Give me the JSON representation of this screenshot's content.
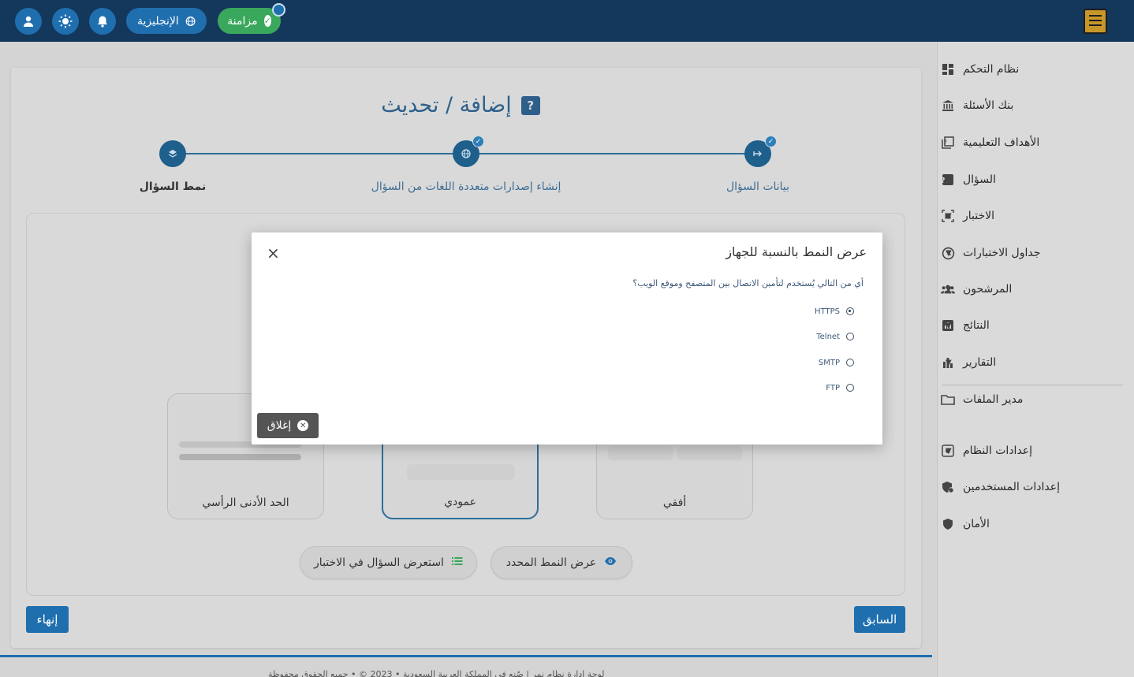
{
  "topbar": {
    "sync_label": "مزامنة",
    "language_label": "الإنجليزية"
  },
  "sidebar": {
    "items": [
      {
        "label": "نظام التحكم",
        "icon": "dashboard-icon",
        "has_caret": false
      },
      {
        "label": "بنك الأسئلة",
        "icon": "bank-icon",
        "has_caret": false
      },
      {
        "label": "الأهداف التعليمية",
        "icon": "objectives-icon",
        "has_caret": false
      },
      {
        "label": "السؤال",
        "icon": "question-icon",
        "has_caret": true
      },
      {
        "label": "الاختبار",
        "icon": "exam-icon",
        "has_caret": true
      },
      {
        "label": "جداول الاختبارات",
        "icon": "clock-icon",
        "has_caret": true
      },
      {
        "label": "المرشحون",
        "icon": "people-icon",
        "has_caret": true
      },
      {
        "label": "النتائج",
        "icon": "results-icon",
        "has_caret": true
      },
      {
        "label": "التقارير",
        "icon": "bar-chart-icon",
        "has_caret": true
      },
      {
        "label": "مدير الملفات",
        "icon": "folder-icon",
        "has_caret": false
      },
      {
        "label": "إعدادات النظام",
        "icon": "settings-icon",
        "has_caret": true
      },
      {
        "label": "إعدادات المستخدمين",
        "icon": "user-settings-icon",
        "has_caret": true
      },
      {
        "label": "الأمان",
        "icon": "shield-icon",
        "has_caret": true
      }
    ]
  },
  "page": {
    "title": "إضافة / تحديث"
  },
  "stepper": {
    "steps": [
      {
        "label": "بيانات السؤال"
      },
      {
        "label": "إنشاء إصدارات متعددة اللغات من السؤال"
      },
      {
        "label": "نمط السؤال"
      }
    ]
  },
  "layouts": {
    "horizontal": "أفقي",
    "vertical": "عمودي",
    "vertical_min": "الحد الأدنى الرأسي"
  },
  "actions": {
    "preview_selected": "عرض النمط المحدد",
    "preview_in_exam": "استعرض السؤال في الاختبار",
    "previous": "السابق",
    "finish": "إنهاء"
  },
  "footer": {
    "text": "لوحة إدارة نظام نمر | صُنع في المملكة العربية السعودية • 2023 © • جميع الحقوق محفوظة"
  },
  "modal": {
    "title": "عرض النمط بالنسبة للجهاز",
    "question": "أي من التالي يُستخدم لتأمين الاتصال بين المتصفح وموقع الويب؟",
    "options": [
      "HTTPS",
      "Telnet",
      "SMTP",
      "FTP"
    ],
    "selected_option": "HTTPS",
    "close_label": "إغلاق"
  },
  "colors": {
    "topbar": "#14375c",
    "primary": "#1f6faf",
    "success": "#3aa85c"
  }
}
